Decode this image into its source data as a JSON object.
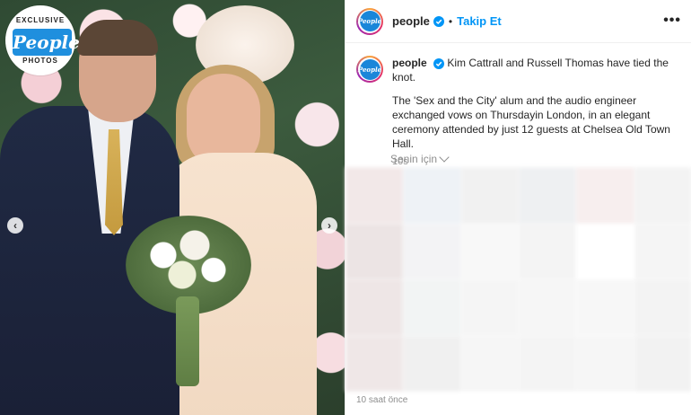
{
  "media": {
    "badge_top": "EXCLUSIVE",
    "badge_logo": "People",
    "badge_bottom": "PHOTOS",
    "prev_icon": "chevron-left-icon",
    "next_icon": "chevron-right-icon"
  },
  "header": {
    "avatar_text": "People",
    "username": "people",
    "separator": "•",
    "follow_label": "Takip Et",
    "more_label": "•••"
  },
  "caption": {
    "username": "people",
    "headline": "Kim Cattrall and Russell Thomas have tied the knot.",
    "body": "The 'Sex and the City' alum and the audio engineer exchanged vows on Thursdayin London, in an elegant ceremony attended by just 12 guests at Chelsea Old Town Hall.",
    "time": "10s"
  },
  "for_you": {
    "label": "Senin için"
  },
  "footer": {
    "time": "10 saat önce"
  },
  "colors": {
    "accent": "#0095f6",
    "verified": "#0095f6",
    "blur_cells": [
      "#f2e8e8",
      "#eef2f6",
      "#f1f1f1",
      "#eef0f2",
      "#f7eeee",
      "#f3f3f3",
      "#ece4e4",
      "#f3f3f5",
      "#f8f8f8",
      "#f4f4f4",
      "#ffffff",
      "#f5f5f5",
      "#eee6e6",
      "#f2f4f4",
      "#f5f5f5",
      "#f6f6f6",
      "#f7f7f7",
      "#f3f3f3",
      "#efe7e7",
      "#f0f0f0",
      "#f6f6f6",
      "#f4f4f4",
      "#f6f6f6",
      "#f2f2f2"
    ]
  }
}
